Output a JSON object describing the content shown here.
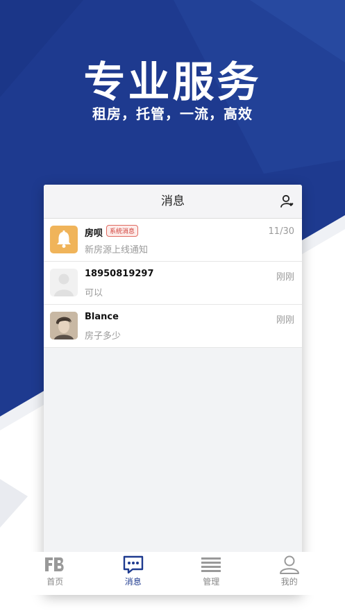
{
  "hero": {
    "title": "专业服务",
    "subtitle": "租房，托管，一流，高效"
  },
  "header": {
    "title": "消息",
    "contacts_icon": "contacts-icon"
  },
  "conversations": [
    {
      "name": "房呗",
      "badge": "系统消息",
      "time": "11/30",
      "message": "新房源上线通知",
      "avatar": "bell-icon"
    },
    {
      "name": "18950819297",
      "time": "刚刚",
      "message": "可以",
      "avatar": "default-avatar-icon"
    },
    {
      "name": "Blance",
      "time": "刚刚",
      "message": "房子多少",
      "avatar": "user-photo"
    }
  ],
  "tabbar": {
    "items": [
      {
        "label": "首页",
        "icon": "fb-logo-icon",
        "active": false
      },
      {
        "label": "消息",
        "icon": "chat-bubble-icon",
        "active": true
      },
      {
        "label": "管理",
        "icon": "list-icon",
        "active": false
      },
      {
        "label": "我的",
        "icon": "person-icon",
        "active": false
      }
    ]
  },
  "colors": {
    "brand_blue": "#1e3a8f",
    "bell_orange": "#f0b45a",
    "badge_red": "#d0403a",
    "muted_text": "#9a9a9a"
  }
}
